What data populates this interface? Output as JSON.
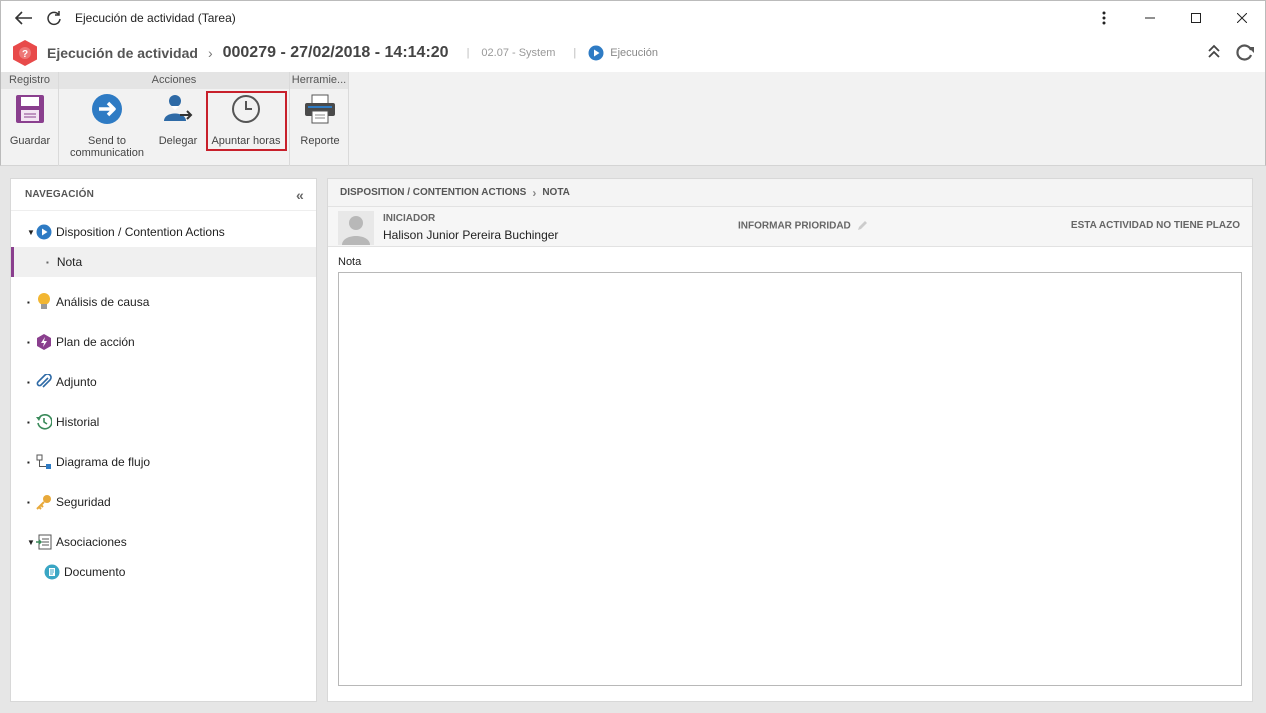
{
  "window": {
    "title": "Ejecución de actividad (Tarea)"
  },
  "header": {
    "title": "Ejecución de actividad",
    "record": "000279 - 27/02/2018 - 14:14:20",
    "system": "02.07 - System",
    "status": "Ejecución",
    "badge_icon": "question-hex-icon"
  },
  "ribbon": {
    "groups": [
      {
        "label": "Registro"
      },
      {
        "label": "Acciones"
      },
      {
        "label": "Herramie..."
      }
    ],
    "buttons": {
      "guardar": "Guardar",
      "send_line1": "Send to",
      "send_line2": "communication",
      "delegar": "Delegar",
      "apuntar": "Apuntar horas",
      "reporte": "Reporte"
    }
  },
  "nav": {
    "heading": "NAVEGACIÓN",
    "items": [
      {
        "label": "Disposition / Contention Actions",
        "icon": "play-circle-icon"
      },
      {
        "label": "Nota"
      },
      {
        "label": "Análisis de causa",
        "icon": "lightbulb-icon"
      },
      {
        "label": "Plan de acción",
        "icon": "action-plan-icon"
      },
      {
        "label": "Adjunto",
        "icon": "paperclip-icon"
      },
      {
        "label": "Historial",
        "icon": "history-icon"
      },
      {
        "label": "Diagrama de flujo",
        "icon": "flowchart-icon"
      },
      {
        "label": "Seguridad",
        "icon": "key-icon"
      },
      {
        "label": "Asociaciones",
        "icon": "associations-icon"
      },
      {
        "label": "Documento",
        "icon": "document-icon"
      }
    ]
  },
  "main": {
    "breadcrumb": [
      "DISPOSITION / CONTENTION ACTIONS",
      "NOTA"
    ],
    "initiator_label": "INICIADOR",
    "initiator_name": "Halison Junior Pereira Buchinger",
    "priority": "INFORMAR PRIORIDAD",
    "deadline": "ESTA ACTIVIDAD NO TIENE PLAZO",
    "note_label": "Nota",
    "note_value": ""
  },
  "colors": {
    "accent_purple": "#8a3f8e",
    "highlight_red": "#c8202b",
    "icon_blue": "#2e7bc4"
  }
}
